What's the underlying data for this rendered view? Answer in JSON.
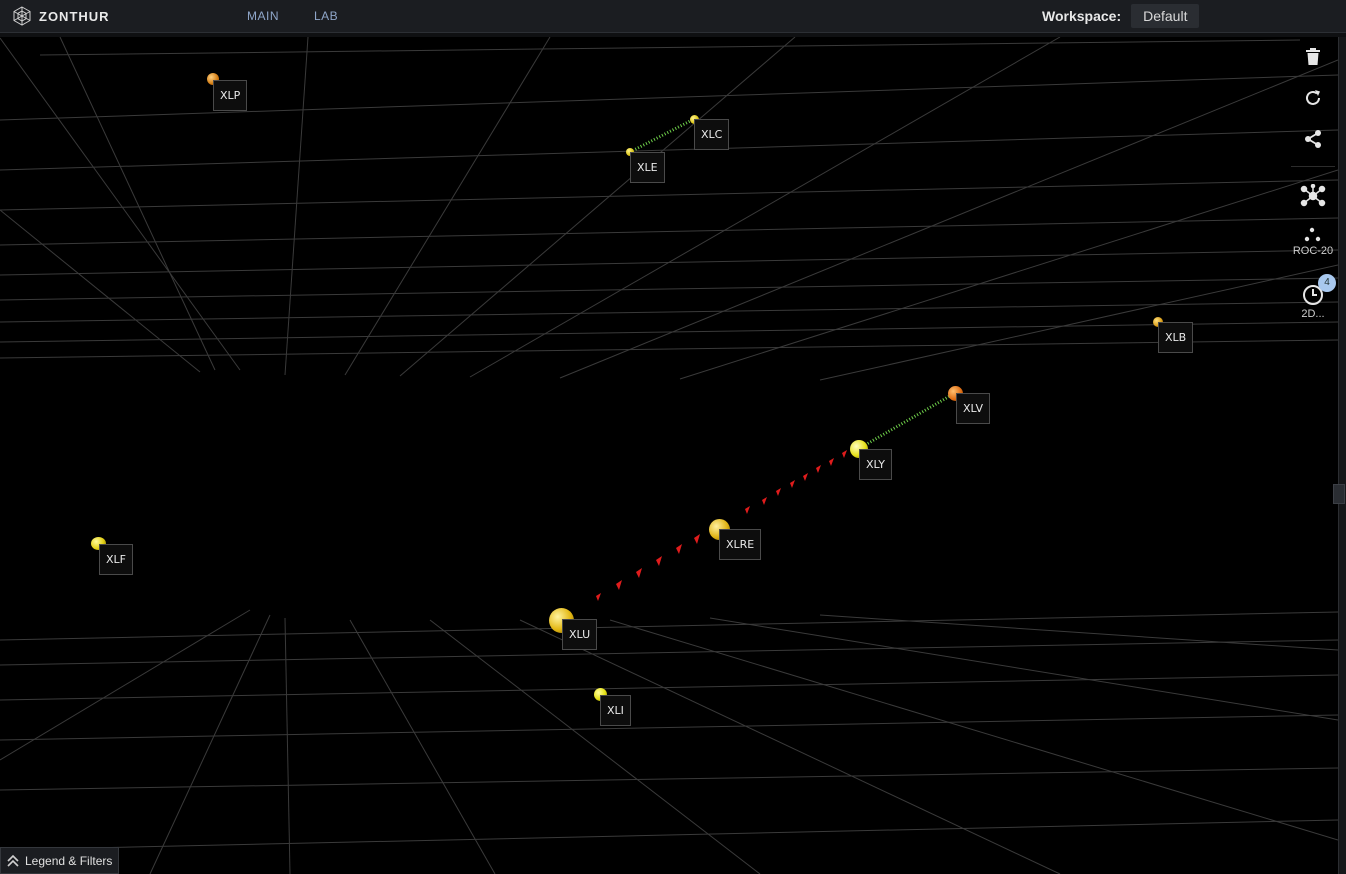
{
  "app": {
    "brand": "ZONTHUR"
  },
  "nav": [
    {
      "label": "MAIN"
    },
    {
      "label": "LAB"
    }
  ],
  "workspace": {
    "label": "Workspace:",
    "value": "Default"
  },
  "toolbar": {
    "roc_caption": "ROC-20",
    "history_caption": "2D...",
    "history_badge": "4"
  },
  "legend": {
    "label": "Legend & Filters"
  },
  "colors": {
    "background": "#000000",
    "grid": "#3a3a3a",
    "node_yellow": "#e8d21a",
    "node_orange": "#e07a15",
    "link_green": "#6fcf4a",
    "link_red": "#e01c1c"
  },
  "nodes": [
    {
      "id": "XLP",
      "label": "XLP",
      "color": "orange"
    },
    {
      "id": "XLC",
      "label": "XLC",
      "color": "yellow"
    },
    {
      "id": "XLE",
      "label": "XLE",
      "color": "yellow"
    },
    {
      "id": "XLB",
      "label": "XLB",
      "color": "orange"
    },
    {
      "id": "XLV",
      "label": "XLV",
      "color": "orange"
    },
    {
      "id": "XLY",
      "label": "XLY",
      "color": "yellow"
    },
    {
      "id": "XLRE",
      "label": "XLRE",
      "color": "yellow"
    },
    {
      "id": "XLF",
      "label": "XLF",
      "color": "yellow"
    },
    {
      "id": "XLU",
      "label": "XLU",
      "color": "yellow"
    },
    {
      "id": "XLI",
      "label": "XLI",
      "color": "yellow"
    }
  ],
  "links": [
    {
      "from": "XLE",
      "to": "XLC",
      "style": "green-dotted"
    },
    {
      "from": "XLY",
      "to": "XLV",
      "style": "green-dotted"
    },
    {
      "from": "XLU",
      "to": "XLY",
      "style": "red-chevrons"
    }
  ]
}
